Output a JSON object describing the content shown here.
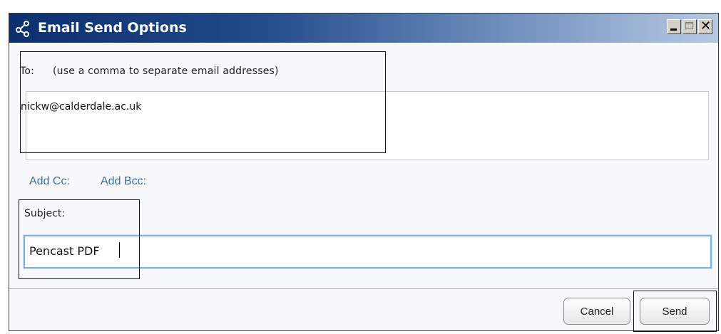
{
  "window": {
    "title": "Email Send Options",
    "controls": {
      "minimize_icon": "minimize-icon",
      "maximize_icon": "maximize-icon",
      "close_icon": "close-icon"
    }
  },
  "to_section": {
    "label": "To:",
    "hint": "(use a comma to separate email addresses)",
    "value": "nickw@calderdale.ac.uk"
  },
  "links": {
    "add_cc": "Add Cc:",
    "add_bcc": "Add Bcc:"
  },
  "subject_section": {
    "label": "Subject:",
    "value": "Pencast PDF"
  },
  "footer": {
    "cancel_label": "Cancel",
    "send_label": "Send"
  },
  "colors": {
    "title_bar": "#0b2f6f",
    "link": "#3a6ea5",
    "focus_border": "#7fb2e5"
  }
}
